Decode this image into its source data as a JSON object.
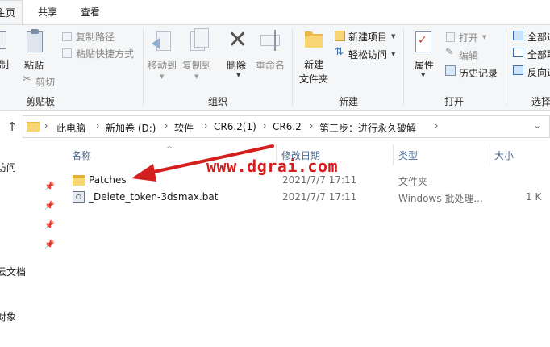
{
  "ribbon_tabs": {
    "home": "主页",
    "share": "共享",
    "view": "查看"
  },
  "clipboard": {
    "pin_label": "制",
    "paste_label": "粘贴",
    "copy_path": "复制路径",
    "paste_shortcut": "粘贴快捷方式",
    "cut": "剪切",
    "group": "剪贴板"
  },
  "organize": {
    "move_to": "移动到",
    "copy_to": "复制到",
    "delete": "删除",
    "rename": "重命名",
    "group": "组织"
  },
  "new_group": {
    "new_folder_line1": "新建",
    "new_folder_line2": "文件夹",
    "new_item": "新建项目",
    "easy_access": "轻松访问",
    "group": "新建"
  },
  "open_group": {
    "properties": "属性",
    "open": "打开",
    "edit": "编辑",
    "history": "历史记录",
    "group": "打开"
  },
  "select_group": {
    "select_all": "全部选",
    "select_none": "全部取",
    "invert": "反向选",
    "group": "选择"
  },
  "address": {
    "crumbs": [
      "此电脑",
      "新加卷 (D:)",
      "软件",
      "CR6.2(1)",
      "CR6.2",
      "第三步：进行永久破解"
    ]
  },
  "nav": {
    "items": [
      "访问",
      "云文档",
      "",
      "对象"
    ]
  },
  "columns": {
    "name": "名称",
    "date": "修改日期",
    "type": "类型",
    "size": "大小"
  },
  "files": [
    {
      "name": "Patches",
      "date": "2021/7/7 17:11",
      "type": "文件夹",
      "size": "",
      "icon": "folder-icon"
    },
    {
      "name": "_Delete_token-3dsmax.bat",
      "date": "2021/7/7 17:11",
      "type": "Windows 批处理...",
      "size": "1 K",
      "icon": "batch-file-icon"
    }
  ],
  "watermark": "www.dgrai.com",
  "colors": {
    "accent_red": "#d41f1f",
    "folder_yellow": "#f7d572",
    "header_blue": "#4d6b91"
  }
}
